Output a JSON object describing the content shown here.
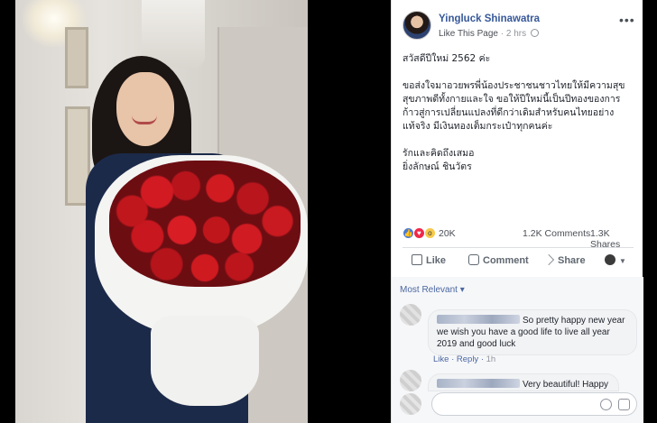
{
  "post": {
    "page_name": "Yingluck Shinawatra",
    "like_page": "Like This Page",
    "time": "2 hrs",
    "text": [
      "สวัสดีปีใหม่ 2562 ค่ะ",
      "ขอส่งใจมาอวยพรพี่น้องประชาชนชาวไทยให้มีความสุข สุขภาพดีทั้งกายและใจ ขอให้ปีใหม่นี้เป็นปีทองของการก้าวสู่การเปลี่ยนแปลงที่ดีกว่าเดิมสำหรับคนไทยอย่างแท้จริง มีเงินทองเต็มกระเป๋าทุกคนค่ะ",
      "รักและคิดถึงเสมอ\nยิ่งลักษณ์ ชินวัตร"
    ]
  },
  "reactions": {
    "count": "20K",
    "comments": "1.2K Comments",
    "shares": "1.3K Shares",
    "icons": [
      "like-icon",
      "love-icon",
      "wow-icon"
    ]
  },
  "actions": {
    "like": "Like",
    "comment": "Comment",
    "share": "Share"
  },
  "comments": {
    "filter_label": "Most Relevant ▾",
    "items": [
      {
        "text": "So pretty happy new year we wish you have a good life to live all year 2019 and good luck",
        "like": "Like",
        "reply": "Reply",
        "time": "1h"
      },
      {
        "text": "Very beautiful! Happy"
      }
    ]
  },
  "colors": {
    "link_blue": "#365899",
    "text": "#1d2129",
    "muted": "#90949c"
  }
}
